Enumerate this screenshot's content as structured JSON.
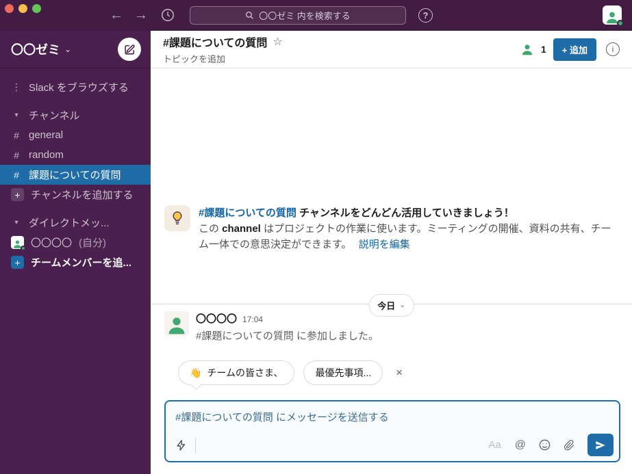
{
  "colors": {
    "topbar": "#431c44",
    "sidebar": "#4a214e",
    "sidebartext": "#cfc3cf",
    "accent": "#1f6da8",
    "link": "#1264a3",
    "presence": "#40a871",
    "text": "#1d1c1d",
    "muted": "#616061",
    "composerbg": "#f8fbfe",
    "placeholder": "#3b6c91"
  },
  "icons": {
    "back": "←",
    "forward": "→",
    "question": "?",
    "info": "i",
    "chevron_down": "⌄",
    "caret_down": "▾",
    "dots": "⋮",
    "hash": "#",
    "plus": "+",
    "close": "×",
    "star": "☆",
    "at": "@",
    "aa": "Aa",
    "wave": "👋"
  },
  "topbar": {
    "search_placeholder": "〇〇ゼミ 内を検索する"
  },
  "sidebar": {
    "workspace_name": "〇〇ゼミ",
    "browse_label": "Slack をブラウズする",
    "channels_section": "チャンネル",
    "channels": [
      "general",
      "random",
      "課題についての質問"
    ],
    "add_channel_label": "チャンネルを追加する",
    "dm_section": "ダイレクトメッ...",
    "dm_user_name": "〇〇〇〇",
    "dm_user_suffix": "(自分)",
    "add_member_label": "チームメンバーを追..."
  },
  "header": {
    "channel_title": "#課題についての質問",
    "topic_placeholder": "トピックを追加",
    "member_count": "1",
    "add_button_label": "+ 追加"
  },
  "welcome": {
    "channel_link": "#課題についての質問",
    "title_rest": " チャンネルをどんどん活用していきましょう！",
    "body_intro": "この ",
    "body_channel_word": "channel",
    "body_rest": " はプロジェクトの作業に使います。ミーティングの開催、資料の共有、チーム一体での意思決定ができます。",
    "edit_link": "説明を編集"
  },
  "date_divider": {
    "label": "今日"
  },
  "message": {
    "author": "〇〇〇〇",
    "time": "17:04",
    "body": "#課題についての質問 に参加しました。"
  },
  "suggestions": {
    "chip1": "チームの皆さま、",
    "chip2": "最優先事項..."
  },
  "composer": {
    "placeholder": "#課題についての質問 にメッセージを送信する"
  }
}
